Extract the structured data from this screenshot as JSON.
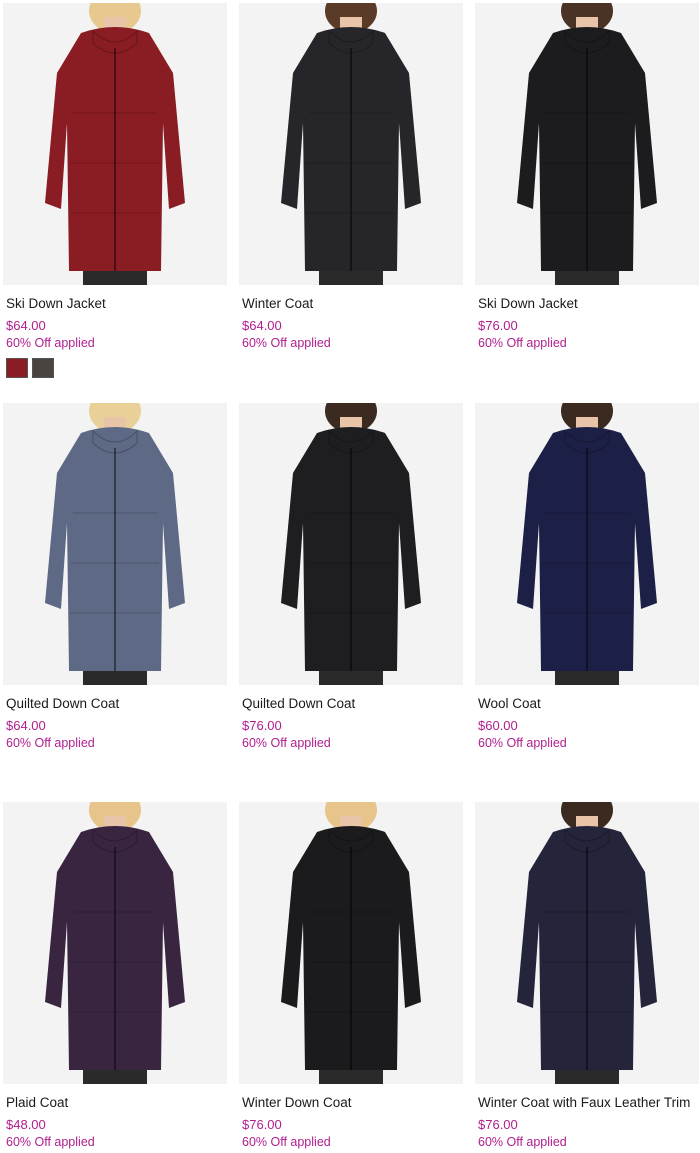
{
  "products": [
    {
      "name": "Ski Down Jacket",
      "price": "$64.00",
      "promo": "60% Off applied",
      "color": "#8a1c24",
      "hair": "#e7c98f",
      "swatches": [
        "#8a1c24",
        "#4a4440"
      ]
    },
    {
      "name": "Winter Coat",
      "price": "$64.00",
      "promo": "60% Off applied",
      "color": "#26262a",
      "hair": "#5a3b27"
    },
    {
      "name": "Ski Down Jacket",
      "price": "$76.00",
      "promo": "60% Off applied",
      "color": "#1c1c1e",
      "hair": "#4a3224"
    },
    {
      "name": "Quilted Down Coat",
      "price": "$64.00",
      "promo": "60% Off applied",
      "color": "#5e6a85",
      "hair": "#e9cf98"
    },
    {
      "name": "Quilted Down Coat",
      "price": "$76.00",
      "promo": "60% Off applied",
      "color": "#1e1e20",
      "hair": "#3a2a20"
    },
    {
      "name": "Wool Coat",
      "price": "$60.00",
      "promo": "60% Off applied",
      "color": "#1d2046",
      "hair": "#3a2a20"
    },
    {
      "name": "Plaid Coat",
      "price": "$48.00",
      "promo": "60% Off applied",
      "color": "#3a2540",
      "hair": "#e6c48a"
    },
    {
      "name": "Winter Down Coat",
      "price": "$76.00",
      "promo": "60% Off applied",
      "color": "#1b1b1d",
      "hair": "#e6c48a"
    },
    {
      "name": "Winter Coat with Faux Leather Trim",
      "price": "$76.00",
      "promo": "60% Off applied",
      "color": "#24243a",
      "hair": "#3a2a20"
    }
  ]
}
